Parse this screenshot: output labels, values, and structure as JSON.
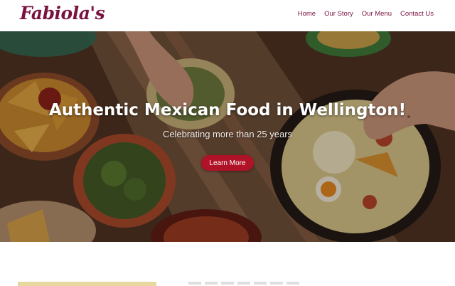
{
  "header": {
    "logo_text": "Fabiola's",
    "nav": [
      "Home",
      "Our Story",
      "Our Menu",
      "Contact Us"
    ]
  },
  "hero": {
    "title": "Authentic Mexican Food in Wellington!",
    "subtitle": "Celebrating more than 25 years",
    "button_label": "Learn More"
  },
  "colors": {
    "brand": "#7a1240",
    "button": "#b01227",
    "white": "#ffffff"
  }
}
